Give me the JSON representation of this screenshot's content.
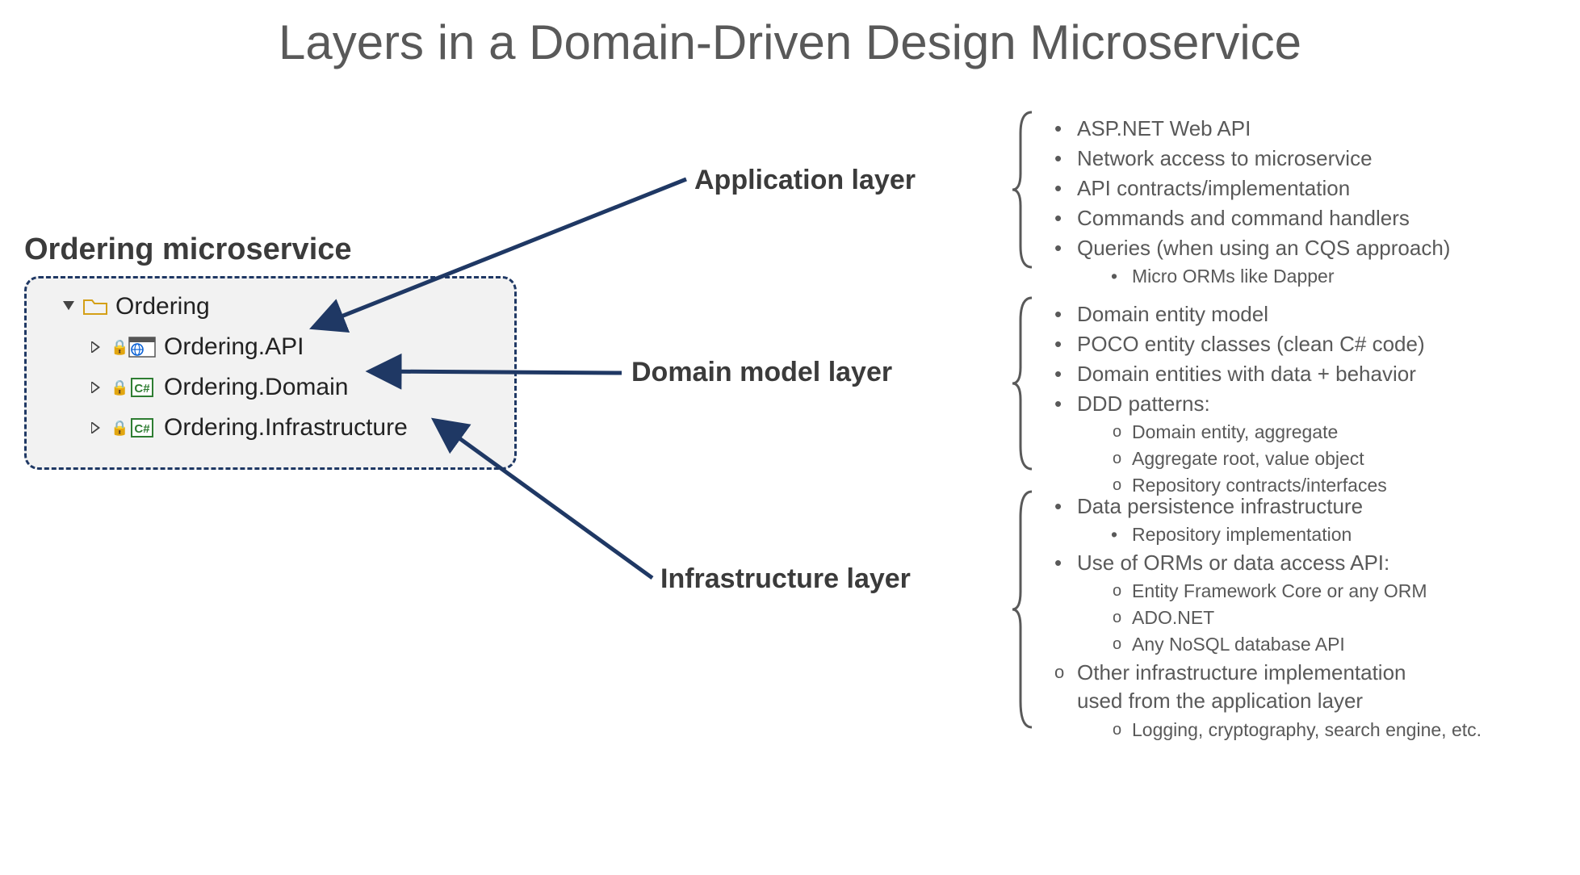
{
  "title": "Layers in a Domain-Driven Design Microservice",
  "microservice_label": "Ordering microservice",
  "solution": {
    "root": "Ordering",
    "projects": [
      {
        "name": "Ordering.API",
        "type": "web"
      },
      {
        "name": "Ordering.Domain",
        "type": "cs"
      },
      {
        "name": "Ordering.Infrastructure",
        "type": "cs"
      }
    ]
  },
  "layers": {
    "application": {
      "title": "Application layer",
      "bullets": [
        "ASP.NET Web API",
        "Network access to microservice",
        "API contracts/implementation",
        "Commands and command handlers",
        "Queries (when using an CQS approach)"
      ],
      "sub_last": [
        "Micro ORMs like Dapper"
      ]
    },
    "domain": {
      "title": "Domain model layer",
      "bullets": [
        "Domain entity model",
        "POCO entity classes (clean C# code)",
        "Domain entities with data + behavior",
        "DDD patterns:"
      ],
      "sub_last": [
        "Domain entity, aggregate",
        "Aggregate root, value object",
        "Repository contracts/interfaces"
      ]
    },
    "infrastructure": {
      "title": "Infrastructure layer",
      "b1": "Data persistence infrastructure",
      "b1_sub": [
        "Repository implementation"
      ],
      "b2": "Use of ORMs or data access API:",
      "b2_sub": [
        "Entity Framework Core or any ORM",
        "ADO.NET",
        "Any NoSQL database API"
      ],
      "b3a": "Other infrastructure implementation",
      "b3b": "used from the application layer",
      "b3_sub": [
        "Logging, cryptography, search engine, etc."
      ]
    }
  },
  "colors": {
    "arrow": "#1f3864",
    "text_gray": "#595959"
  }
}
